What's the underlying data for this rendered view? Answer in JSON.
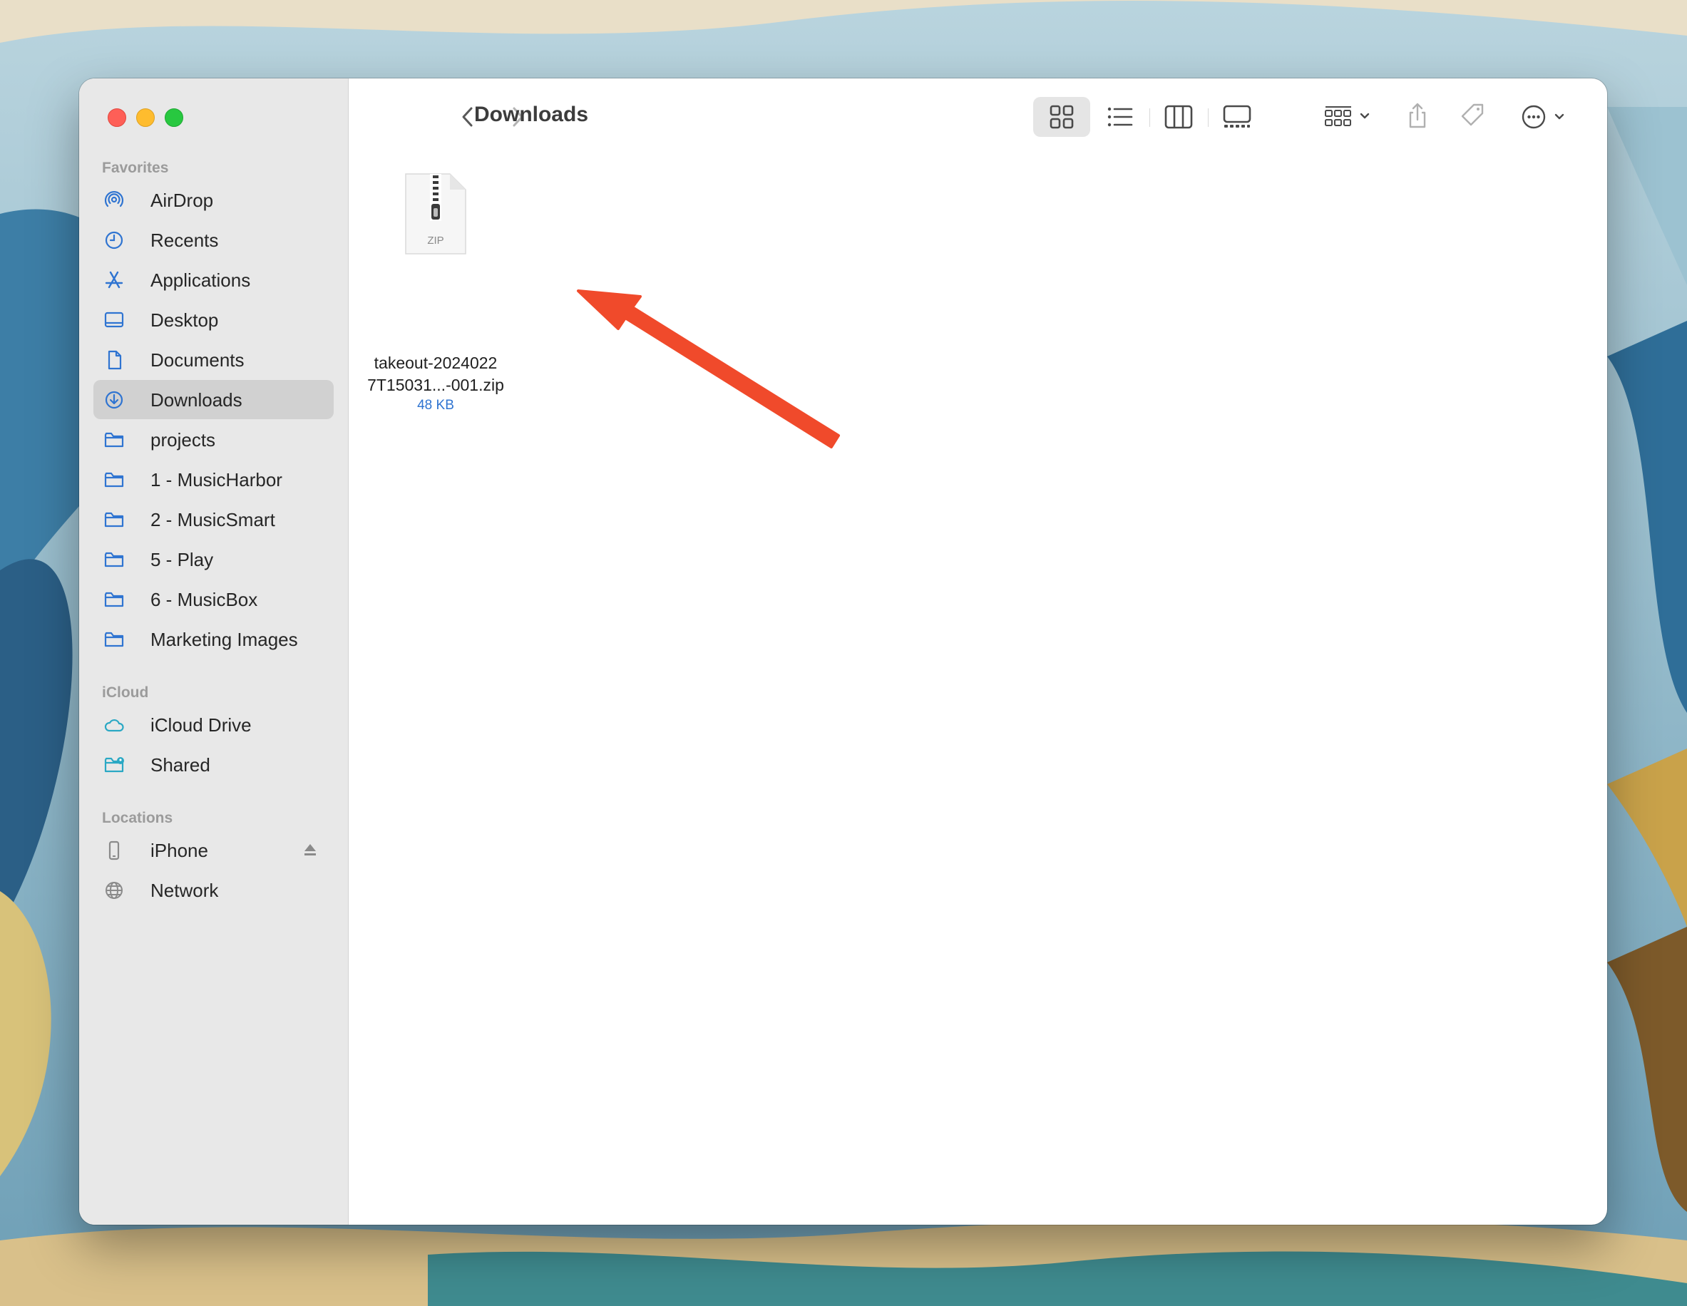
{
  "window": {
    "title": "Downloads"
  },
  "sidebar": {
    "favorites_label": "Favorites",
    "favorites": [
      {
        "label": "AirDrop",
        "icon": "airdrop-icon"
      },
      {
        "label": "Recents",
        "icon": "clock-icon"
      },
      {
        "label": "Applications",
        "icon": "applications-icon"
      },
      {
        "label": "Desktop",
        "icon": "desktop-icon"
      },
      {
        "label": "Documents",
        "icon": "document-icon"
      },
      {
        "label": "Downloads",
        "icon": "download-icon",
        "selected": true
      },
      {
        "label": "projects",
        "icon": "folder-icon"
      },
      {
        "label": "1 - MusicHarbor",
        "icon": "folder-icon"
      },
      {
        "label": "2 - MusicSmart",
        "icon": "folder-icon"
      },
      {
        "label": "5 - Play",
        "icon": "folder-icon"
      },
      {
        "label": "6 - MusicBox",
        "icon": "folder-icon"
      },
      {
        "label": "Marketing Images",
        "icon": "folder-icon"
      }
    ],
    "icloud_label": "iCloud",
    "icloud": [
      {
        "label": "iCloud Drive",
        "icon": "cloud-icon"
      },
      {
        "label": "Shared",
        "icon": "shared-folder-icon"
      }
    ],
    "locations_label": "Locations",
    "locations": [
      {
        "label": "iPhone",
        "icon": "iphone-icon"
      },
      {
        "label": "Network",
        "icon": "globe-icon"
      }
    ]
  },
  "files": [
    {
      "name_line1": "takeout-2024022",
      "name_line2": "7T15031...-001.zip",
      "size": "48 KB",
      "icon_label": "ZIP"
    }
  ],
  "colors": {
    "accent": "#2f74d1",
    "arrow": "#f04a2b",
    "sidebar_bg": "#e8e8e8",
    "selected_bg": "#d1d1d1"
  }
}
